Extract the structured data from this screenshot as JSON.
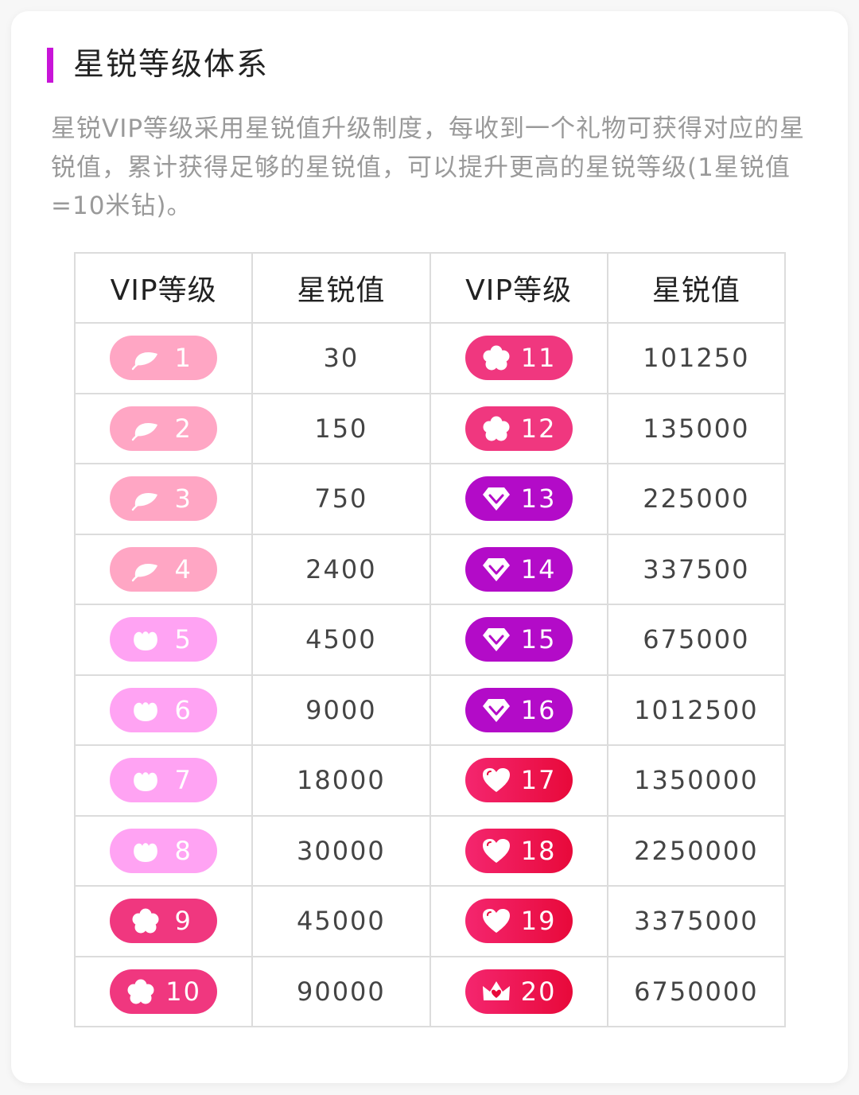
{
  "title": "星锐等级体系",
  "description": "星锐VIP等级采用星锐值升级制度，每收到一个礼物可获得对应的星锐值，累计获得足够的星锐值，可以提升更高的星锐等级(1星锐值=10米钻)。",
  "table": {
    "headers": [
      "VIP等级",
      "星锐值",
      "VIP等级",
      "星锐值"
    ],
    "rows": [
      {
        "left": {
          "level": "1",
          "value": "30",
          "icon": "leaf-icon",
          "color": "#ffa6c4"
        },
        "right": {
          "level": "11",
          "value": "101250",
          "icon": "flower-icon",
          "color": "#f0377f"
        }
      },
      {
        "left": {
          "level": "2",
          "value": "150",
          "icon": "leaf-icon",
          "color": "#ffa6c4"
        },
        "right": {
          "level": "12",
          "value": "135000",
          "icon": "flower-icon",
          "color": "#f0377f"
        }
      },
      {
        "left": {
          "level": "3",
          "value": "750",
          "icon": "leaf-icon",
          "color": "#ffa6c4"
        },
        "right": {
          "level": "13",
          "value": "225000",
          "icon": "diamond-icon",
          "color": "#b30bc8"
        }
      },
      {
        "left": {
          "level": "4",
          "value": "2400",
          "icon": "leaf-icon",
          "color": "#ffa6c4"
        },
        "right": {
          "level": "14",
          "value": "337500",
          "icon": "diamond-icon",
          "color": "#b30bc8"
        }
      },
      {
        "left": {
          "level": "5",
          "value": "4500",
          "icon": "bud-icon",
          "color": "#ffa3f3"
        },
        "right": {
          "level": "15",
          "value": "675000",
          "icon": "diamond-icon",
          "color": "#b30bc8"
        }
      },
      {
        "left": {
          "level": "6",
          "value": "9000",
          "icon": "bud-icon",
          "color": "#ffa3f3"
        },
        "right": {
          "level": "16",
          "value": "1012500",
          "icon": "diamond-icon",
          "color": "#b30bc8"
        }
      },
      {
        "left": {
          "level": "7",
          "value": "18000",
          "icon": "bud-icon",
          "color": "#ffa3f3"
        },
        "right": {
          "level": "17",
          "value": "1350000",
          "icon": "heart-icon",
          "color": "#e8093a"
        }
      },
      {
        "left": {
          "level": "8",
          "value": "30000",
          "icon": "bud-icon",
          "color": "#ffa3f3"
        },
        "right": {
          "level": "18",
          "value": "2250000",
          "icon": "heart-icon",
          "color": "#e8093a"
        }
      },
      {
        "left": {
          "level": "9",
          "value": "45000",
          "icon": "flower-icon",
          "color": "#f0377f"
        },
        "right": {
          "level": "19",
          "value": "3375000",
          "icon": "heart-icon",
          "color": "#e8093a"
        }
      },
      {
        "left": {
          "level": "10",
          "value": "90000",
          "icon": "flower-icon",
          "color": "#f0377f"
        },
        "right": {
          "level": "20",
          "value": "6750000",
          "icon": "crown-icon",
          "color": "#e8093a"
        }
      }
    ]
  }
}
